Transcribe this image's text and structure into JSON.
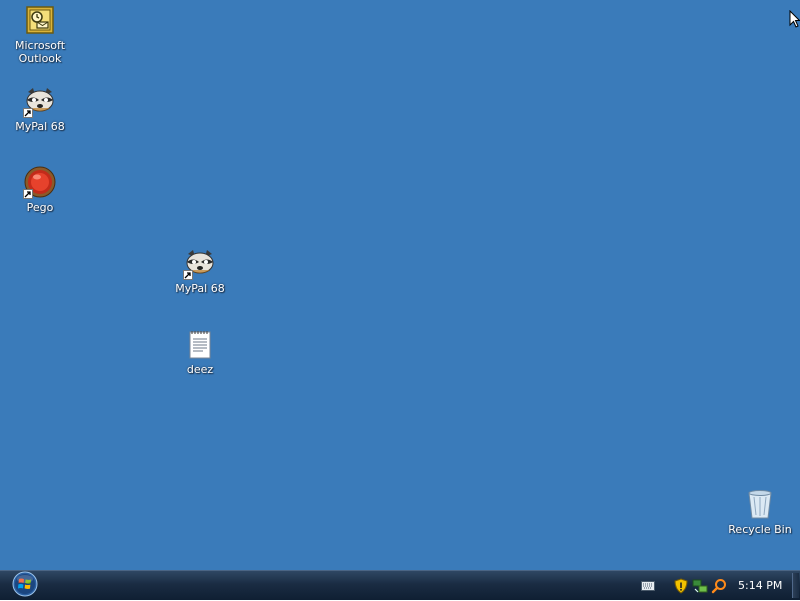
{
  "desktop": {
    "background_color": "#3a7bba",
    "icons": [
      {
        "label": "Microsoft\nOutlook",
        "icon": "outlook-icon",
        "shortcut": false
      },
      {
        "label": "MyPal 68",
        "icon": "raccoon-icon",
        "shortcut": true
      },
      {
        "label": "Pego",
        "icon": "red-button-icon",
        "shortcut": true
      },
      {
        "label": "MyPal 68",
        "icon": "raccoon-icon",
        "shortcut": true
      },
      {
        "label": "deez",
        "icon": "text-document-icon",
        "shortcut": false
      },
      {
        "label": "Recycle Bin",
        "icon": "recycle-bin-icon",
        "shortcut": false
      }
    ]
  },
  "taskbar": {
    "start_icon": "windows-orb-icon",
    "tray_icons": [
      "keyboard-icon",
      "security-shield-icon",
      "network-icon",
      "search-icon"
    ],
    "clock": "5:14 PM"
  }
}
